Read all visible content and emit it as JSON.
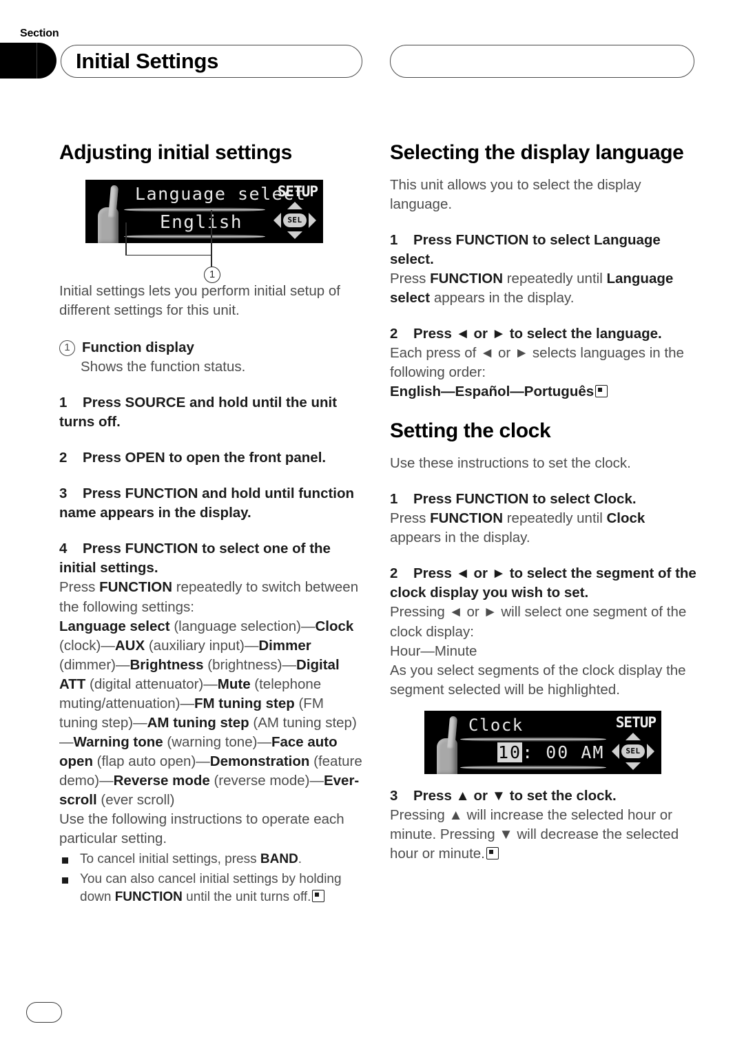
{
  "header": {
    "section_label": "Section",
    "title": "Initial Settings"
  },
  "footer": {
    "page_number": ""
  },
  "left_column": {
    "heading": "Adjusting initial settings",
    "figure": {
      "name": "language-select-lcd",
      "line1": "Language select",
      "line2": "English",
      "badge": "SETUP",
      "joystick_hub": "SEL",
      "callout_marker": "1"
    },
    "intro": "Initial settings lets you perform initial setup of different settings for this unit.",
    "callout": {
      "marker": "1",
      "label": "Function display",
      "description": "Shows the function status."
    },
    "steps": [
      {
        "num": "1",
        "text": "Press SOURCE and hold until the unit turns off."
      },
      {
        "num": "2",
        "text": "Press OPEN to open the front panel."
      },
      {
        "num": "3",
        "text": "Press FUNCTION and hold until function name appears in the display."
      },
      {
        "num": "4",
        "text": "Press FUNCTION to select one of the initial settings."
      }
    ],
    "step4_body_prefix": "Press ",
    "step4_body_key": "FUNCTION",
    "step4_body_suffix": " repeatedly to switch between the following settings:",
    "settings_sequence": [
      {
        "bold": "Language select",
        "plain": " (language selection)"
      },
      {
        "bold": "Clock",
        "plain": " (clock)"
      },
      {
        "bold": "AUX",
        "plain": " (auxiliary input)"
      },
      {
        "bold": "Dimmer",
        "plain": " (dimmer)"
      },
      {
        "bold": "Brightness",
        "plain": " (brightness)"
      },
      {
        "bold": "Digital ATT",
        "plain": " (digital attenuator)"
      },
      {
        "bold": "Mute",
        "plain": " (telephone muting/attenuation)"
      },
      {
        "bold": "FM tuning step",
        "plain": " (FM tuning step)"
      },
      {
        "bold": "AM tuning step",
        "plain": " (AM tuning step)"
      },
      {
        "bold": "Warning tone",
        "plain": " (warning tone)"
      },
      {
        "bold": "Face auto open",
        "plain": " (flap auto open)"
      },
      {
        "bold": "Demonstration",
        "plain": " (feature demo)"
      },
      {
        "bold": "Reverse mode",
        "plain": " (reverse mode)"
      },
      {
        "bold": "Ever-scroll",
        "plain": " (ever scroll)"
      }
    ],
    "after_settings": "Use the following instructions to operate each particular setting.",
    "bullets": [
      {
        "pre": "To cancel initial settings, press ",
        "key": "BAND",
        "post": "."
      },
      {
        "pre": "You can also cancel initial settings by holding down ",
        "key": "FUNCTION",
        "post": " until the unit turns off."
      }
    ]
  },
  "right_column": {
    "section1": {
      "heading": "Selecting the display language",
      "intro": "This unit allows you to select the display language.",
      "step1": {
        "num": "1",
        "text_a": "Press FUNCTION to select ",
        "text_b": "Language select.",
        "body_pre": "Press ",
        "body_key": "FUNCTION",
        "body_mid": " repeatedly until ",
        "body_key2": "Language select",
        "body_post": " appears in the display."
      },
      "step2": {
        "num": "2",
        "text": "Press ◄ or ► to select the language.",
        "body": "Each press of ◄ or ► selects languages in the following order:",
        "order": "English—Español—Português"
      }
    },
    "section2": {
      "heading": "Setting the clock",
      "intro": "Use these instructions to set the clock.",
      "step1": {
        "num": "1",
        "text": "Press FUNCTION to select Clock.",
        "body_pre": "Press ",
        "body_key": "FUNCTION",
        "body_mid": " repeatedly until ",
        "body_key2": "Clock",
        "body_post": " appears in the display."
      },
      "step2": {
        "num": "2",
        "text": "Press ◄ or ► to select the segment of the clock display you wish to set.",
        "body1": "Pressing ◄ or ► will select one segment of the clock display:",
        "body2": "Hour—Minute",
        "body3": "As you select segments of the clock display the segment selected will be highlighted."
      },
      "figure": {
        "name": "clock-lcd",
        "line1": "Clock",
        "time_highlighted": "10",
        "time_rest": ": 00 AM",
        "badge": "SETUP",
        "joystick_hub": "SEL"
      },
      "step3": {
        "num": "3",
        "text": "Press ▲ or ▼ to set the clock.",
        "body": "Pressing ▲ will increase the selected hour or minute. Pressing ▼ will decrease the selected hour or minute."
      }
    }
  }
}
